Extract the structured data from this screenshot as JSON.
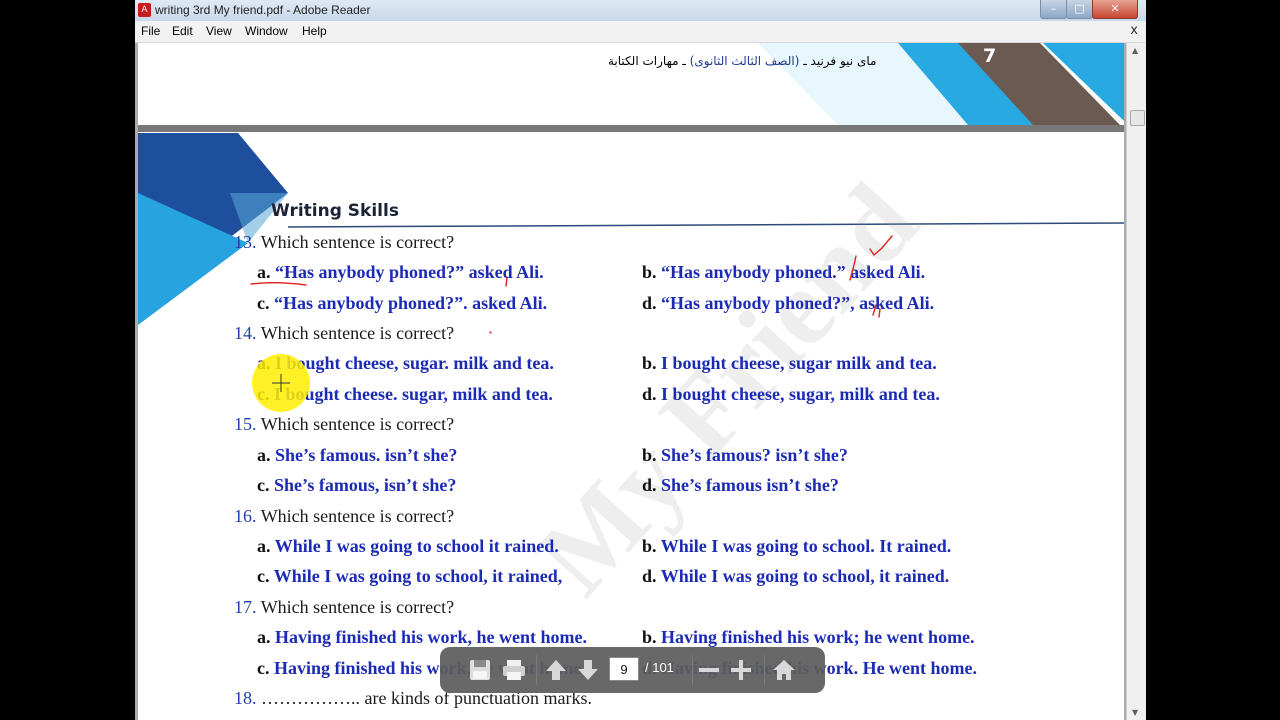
{
  "window": {
    "title": "writing 3rd My friend.pdf - Adobe Reader",
    "app_icon_glyph": "A"
  },
  "window_controls": {
    "minimize": "–",
    "maximize": "□",
    "close": "✕"
  },
  "menu": [
    "File",
    "Edit",
    "View",
    "Window",
    "Help"
  ],
  "document_close": "x",
  "page": {
    "header_arabic": "مای نیو فرنید ـ (الصف الثالث الثانوی) ـ مهارات الكتابة",
    "header_arabic_pre": "مای نیو فرنید ـ ",
    "header_arabic_grade": "(الصف الثالث الثانوی)",
    "header_arabic_post": " ـ مهارات الكتابة",
    "page_number": "7",
    "section_title": "Writing Skills",
    "watermark": "My Friend",
    "questions": [
      {
        "number": "13.",
        "text": "Which sentence is correct?",
        "options": [
          {
            "letter": "a.",
            "text": "“Has anybody phoned?” asked Ali."
          },
          {
            "letter": "b.",
            "text": "“Has anybody phoned.” asked Ali."
          },
          {
            "letter": "c.",
            "text": "“Has anybody phoned?”. asked Ali."
          },
          {
            "letter": "d.",
            "text": "“Has anybody phoned?”, asked Ali."
          }
        ]
      },
      {
        "number": "14.",
        "text": "Which sentence is correct?",
        "options": [
          {
            "letter": "a.",
            "text": "I bought cheese, sugar. milk and tea."
          },
          {
            "letter": "b.",
            "text": "I bought cheese, sugar milk and tea."
          },
          {
            "letter": "c.",
            "text": "I bought cheese. sugar, milk and tea."
          },
          {
            "letter": "d.",
            "text": "I bought cheese, sugar, milk and tea."
          }
        ]
      },
      {
        "number": "15.",
        "text": "Which sentence is correct?",
        "options": [
          {
            "letter": "a.",
            "text": "She’s famous. isn’t she?"
          },
          {
            "letter": "b.",
            "text": "She’s famous? isn’t she?"
          },
          {
            "letter": "c.",
            "text": "She’s famous, isn’t she?"
          },
          {
            "letter": "d.",
            "text": "She’s famous isn’t she?"
          }
        ]
      },
      {
        "number": "16.",
        "text": "Which sentence is correct?",
        "options": [
          {
            "letter": "a.",
            "text": "While I was going to school it rained."
          },
          {
            "letter": "b.",
            "text": "While I was going to school. It rained."
          },
          {
            "letter": "c.",
            "text": "While I was going to school, it rained,"
          },
          {
            "letter": "d.",
            "text": "While I was going to school, it rained."
          }
        ]
      },
      {
        "number": "17.",
        "text": "Which sentence is correct?",
        "options": [
          {
            "letter": "a.",
            "text": "Having finished his work, he went home."
          },
          {
            "letter": "b.",
            "text": "Having finished his work; he went home."
          },
          {
            "letter": "c.",
            "text": "Having finished his work, he went home."
          },
          {
            "letter": "d.",
            "text": "Having finished his work. He went home."
          }
        ]
      },
      {
        "number": "18.",
        "text": "…………….. are kinds of punctuation marks.",
        "options": []
      }
    ]
  },
  "toolbar": {
    "current_page": "9",
    "total_pages": "/ 101",
    "icons": [
      "save-icon",
      "print-icon",
      "page-up-icon",
      "page-down-icon",
      "zoom-out-icon",
      "zoom-in-icon",
      "home-icon"
    ]
  },
  "colors": {
    "accent_blue": "#1c2bb5",
    "header_cyan": "#29a9e1",
    "header_brown": "#6b5a52",
    "annotation_red": "#e02020",
    "highlight_yellow": "#ffee00"
  }
}
